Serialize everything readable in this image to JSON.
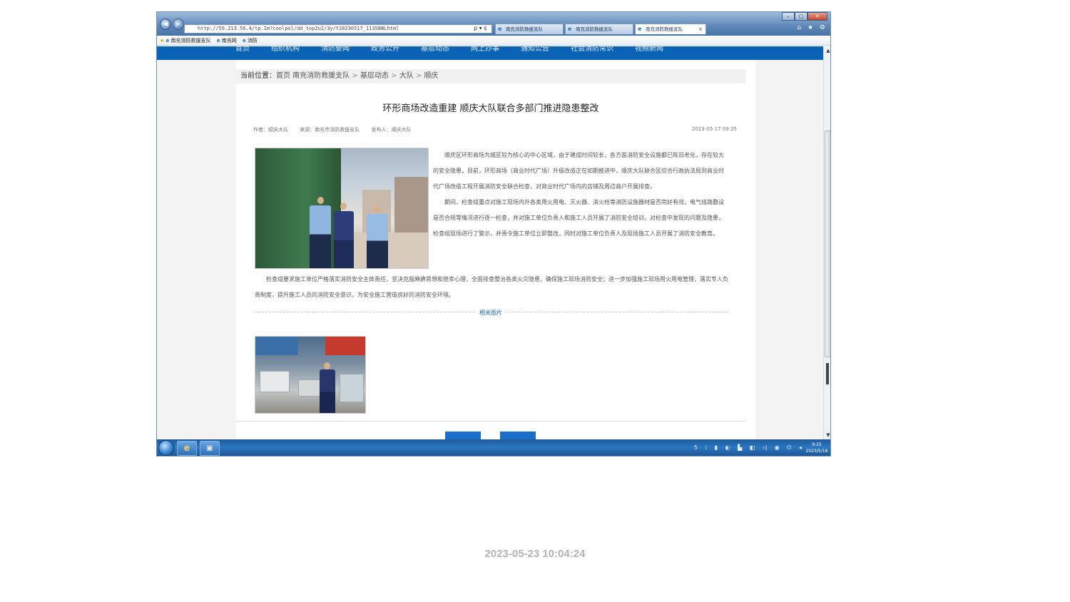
{
  "browser": {
    "address": "http://59.213.56.4/tp.Im?coolpol/dd_top2u2/3y/t20230517_1135BBLhtml",
    "address_tools": "ρ ▾ ¢",
    "tabs": [
      {
        "label": "南充消防救援支队"
      },
      {
        "label": "南充消防救援支队"
      },
      {
        "label": "南充消防救援支队"
      }
    ],
    "tab_close": "×",
    "window_controls": {
      "minimize": "–",
      "maximize": "□",
      "close": "✕"
    },
    "right_icons": "⌂ ★ ⚙",
    "favorites": [
      {
        "label": "南充消防救援支队"
      },
      {
        "label": "南充网"
      },
      {
        "label": "消防"
      }
    ]
  },
  "site": {
    "nav": [
      "首页",
      "组织机构",
      "消防要闻",
      "政务公开",
      "基层动态",
      "网上办事",
      "通知公告",
      "社会消防常识",
      "视频新闻"
    ]
  },
  "breadcrumb": {
    "label": "当前位置：",
    "items": [
      "首页 南充消防救援支队",
      "基层动态",
      "大队",
      "顺庆"
    ],
    "sep": " > "
  },
  "article": {
    "title": "环形商场改造重建 顺庆大队联合多部门推进隐患整改",
    "author": "作者：顺庆大队",
    "source": "来源：南充市消防救援支队",
    "publisher": "发布人：顺庆大队",
    "date": "2023-05-17 09:25",
    "para1": "顺庆区环形商场为城区较为核心的中心区域，由于建成时间较长，各方面消防安全设施都已陈旧老化，存在较大的安全隐患。目前，环形商场（商业时代广场）升级改造正在如期推进中，顺庆大队联合区综合行政执法局到商业时代广场改造工程开展消防安全联合检查，对商业时代广场内的店铺及周边商户开展排查。",
    "para2": "期间，检查组重点对施工现场内外各类用火用电、灭火器、消火栓等消防设施器材是否完好有效，电气线路敷设是否合规等情况进行逐一检查，并对施工单位负责人和施工人员开展了消防安全培训，对检查中发现的问题及隐患，检查组现场进行了警示，并责令施工单位立即整改，同时对施工单位负责人及现场施工人员开展了消防安全教育。",
    "para3": "检查组要求施工单位严格落实消防安全主体责任，坚决克服麻痹思想和侥幸心理，全面排查整治各类火灾隐患，确保施工现场消防安全；进一步加强施工现场用火用电管理，落实专人负责制度，提升施工人员的消防安全意识，为安全施工营造良好的消防安全环境。"
  },
  "related": {
    "label": "相关图片"
  },
  "taskbar": {
    "ie_icon": "e",
    "tray": "5 ⁞ ▮ ◐ ▙ ◧ ◁ ◉ ⏻ ◂",
    "time": "9:25",
    "date": "2023/5/18"
  },
  "scroll": {
    "up": "▲",
    "down": "▼"
  },
  "watermark": "2023-05-23 10:04:24",
  "colors": {
    "site_nav": "#0b63b5",
    "link": "#1a5fb0",
    "taskbar": "#2b78c2"
  }
}
